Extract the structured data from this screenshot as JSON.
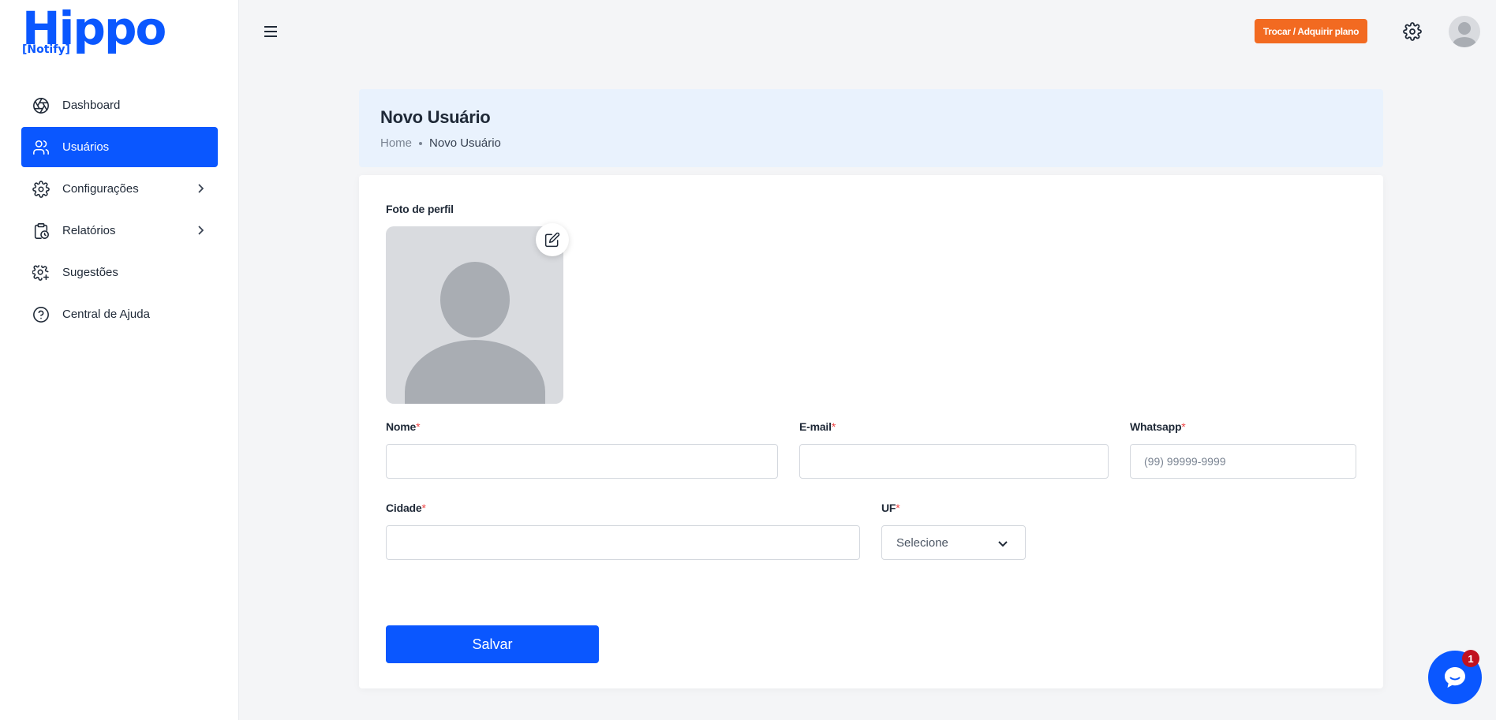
{
  "brand": {
    "logo_main": "Hippo",
    "logo_sub_open": "[",
    "logo_sub": "Notify",
    "logo_sub_close": "]",
    "primary_color": "#0a57ff",
    "accent_color": "#f26a21"
  },
  "sidebar": {
    "items": [
      {
        "label": "Dashboard",
        "icon": "aperture-icon",
        "active": false,
        "has_submenu": false
      },
      {
        "label": "Usuários",
        "icon": "users-icon",
        "active": true,
        "has_submenu": false
      },
      {
        "label": "Configurações",
        "icon": "gear-icon",
        "active": false,
        "has_submenu": true
      },
      {
        "label": "Relatórios",
        "icon": "clipboard-clock-icon",
        "active": false,
        "has_submenu": true
      },
      {
        "label": "Sugestões",
        "icon": "gear-plus-icon",
        "active": false,
        "has_submenu": false
      },
      {
        "label": "Central de Ajuda",
        "icon": "help-circle-icon",
        "active": false,
        "has_submenu": false
      }
    ]
  },
  "topbar": {
    "plan_button": "Trocar / Adquirir plano"
  },
  "page_header": {
    "title": "Novo Usuário",
    "breadcrumb_home": "Home",
    "breadcrumb_current": "Novo Usuário"
  },
  "form": {
    "photo_label": "Foto de perfil",
    "required_mark": "*",
    "nome_label": "Nome",
    "nome_value": "",
    "email_label": "E-mail",
    "email_value": "",
    "whatsapp_label": "Whatsapp",
    "whatsapp_placeholder": "(99) 99999-9999",
    "cidade_label": "Cidade",
    "cidade_value": "",
    "uf_label": "UF",
    "uf_selected": "Selecione",
    "save_button": "Salvar"
  },
  "chat": {
    "badge_count": "1"
  }
}
